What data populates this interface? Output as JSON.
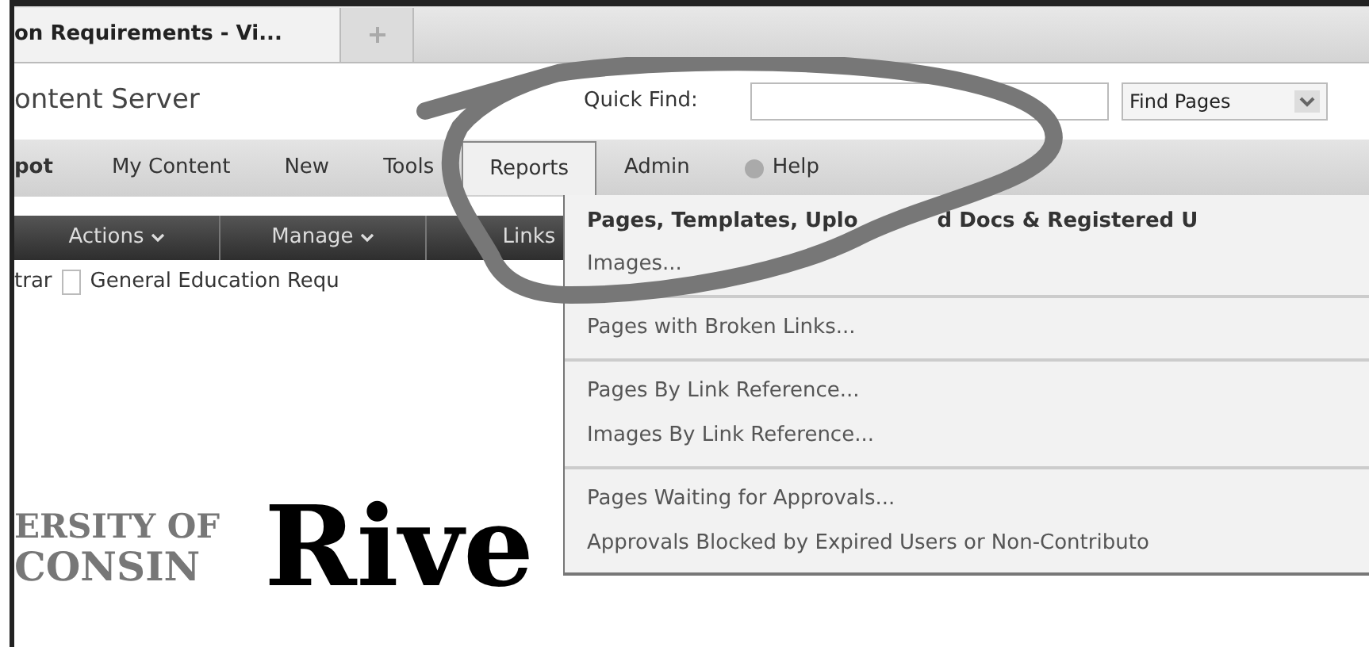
{
  "browser_tabs": [
    {
      "label": "on Requirements - Vi...",
      "selected": true
    }
  ],
  "app_title": "ontent Server",
  "quick_find": {
    "label": "Quick Find:",
    "scope": "Find Pages"
  },
  "nav": [
    {
      "label": "pot",
      "kind": "link",
      "selected": false
    },
    {
      "label": "My Content",
      "kind": "link",
      "selected": false
    },
    {
      "label": "New",
      "kind": "link",
      "selected": false
    },
    {
      "label": "Tools",
      "kind": "link",
      "selected": false
    },
    {
      "label": "Reports",
      "kind": "link",
      "selected": true
    },
    {
      "label": "Admin",
      "kind": "link",
      "selected": false
    },
    {
      "label": "Help",
      "kind": "help",
      "selected": false
    }
  ],
  "toolbar": [
    {
      "label": "Actions",
      "dropdown": true
    },
    {
      "label": "Manage",
      "dropdown": true
    },
    {
      "label": "Links",
      "dropdown": false
    }
  ],
  "breadcrumb": [
    {
      "label": "trar",
      "kind": "text"
    },
    {
      "label": "General Education Requ",
      "kind": "page"
    }
  ],
  "reports_menu": [
    {
      "kind": "heading",
      "parts": [
        "Pages, Templates, Uplo",
        "d Docs & Registered U"
      ]
    },
    {
      "kind": "item",
      "label": "Images..."
    },
    {
      "kind": "separator"
    },
    {
      "kind": "item",
      "label": "Pages with Broken Links..."
    },
    {
      "kind": "separator"
    },
    {
      "kind": "item",
      "label": "Pages By Link Reference..."
    },
    {
      "kind": "item",
      "label": "Images By Link Reference..."
    },
    {
      "kind": "separator"
    },
    {
      "kind": "item",
      "label": "Pages Waiting for Approvals..."
    },
    {
      "kind": "item",
      "label": "Approvals Blocked by Expired Users or Non-Contributo"
    }
  ],
  "logo": {
    "line_1": "ERSITY OF",
    "line_2": "CONSIN",
    "name": "Rive"
  }
}
